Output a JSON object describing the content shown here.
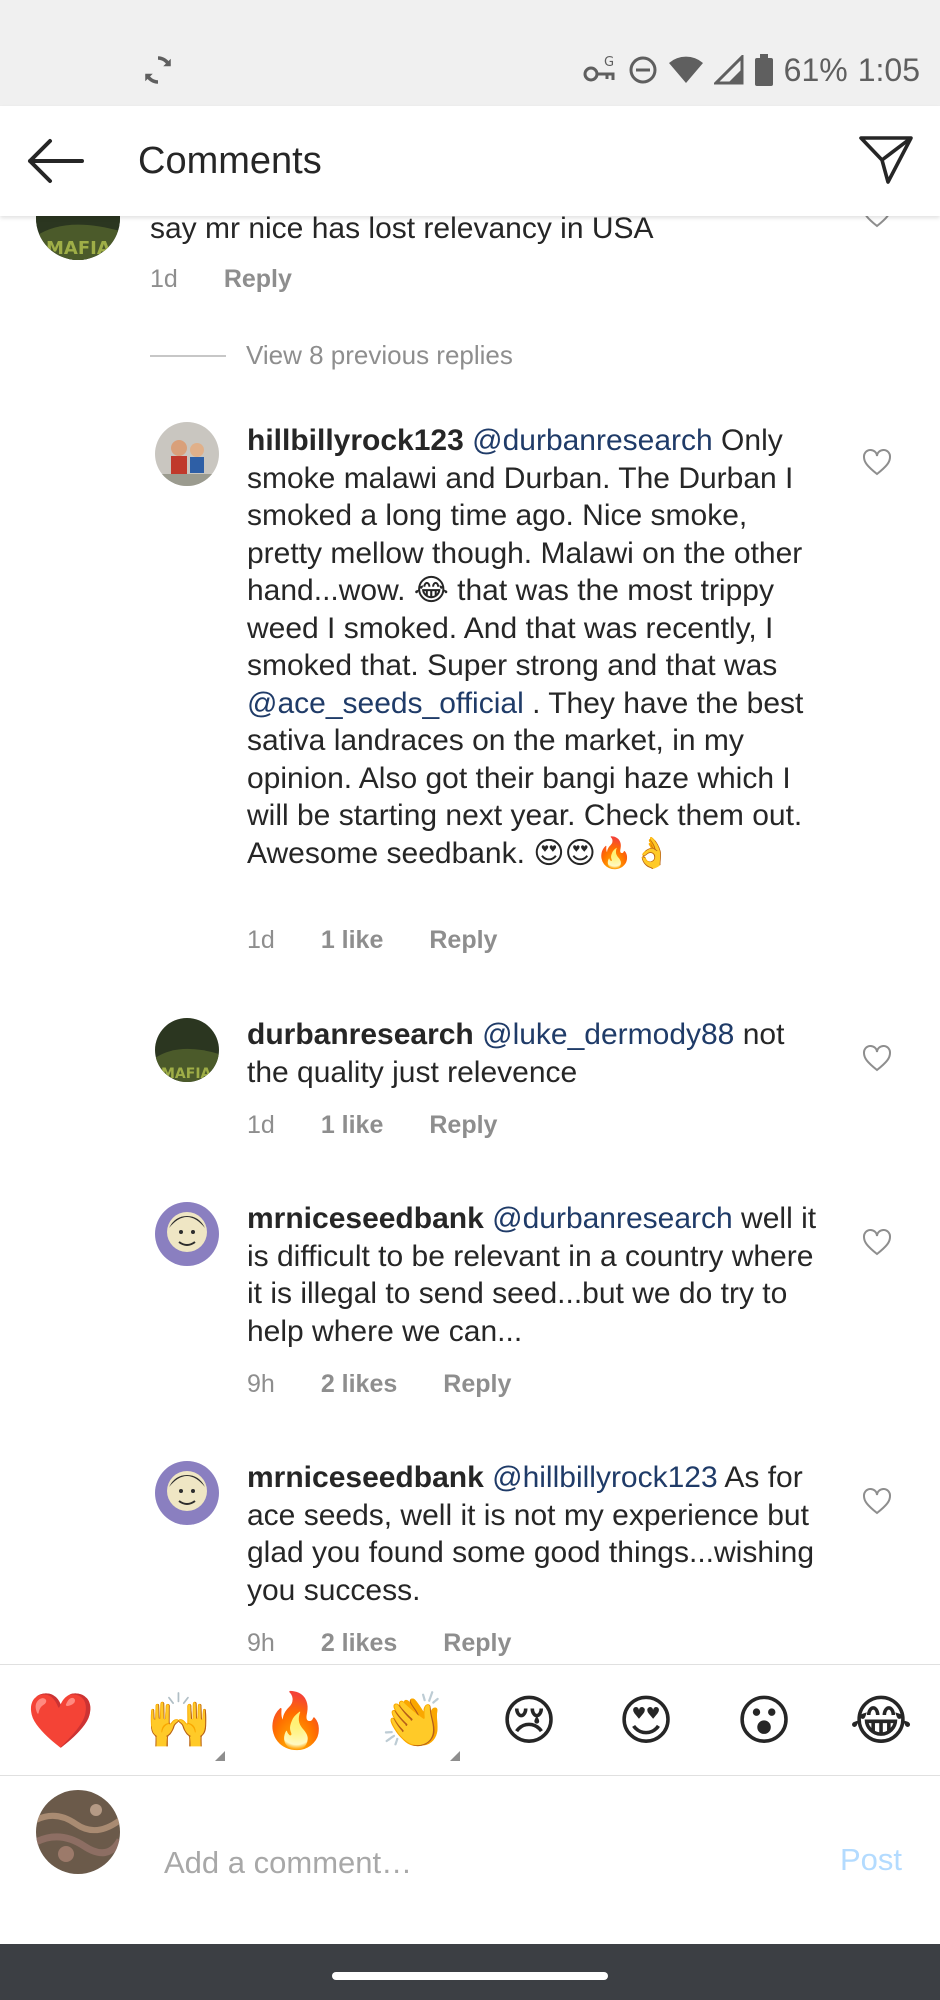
{
  "status_bar": {
    "battery": "61%",
    "time": "1:05"
  },
  "header": {
    "title": "Comments"
  },
  "parent_comment": {
    "text": "say mr nice has lost  relevancy in USA",
    "time": "1d",
    "reply_label": "Reply"
  },
  "view_replies": "View 8 previous replies",
  "replies": [
    {
      "username": "hillbillyrock123",
      "mention": "@durbanresearch",
      "text_1": " Only smoke malawi and Durban.  The Durban I smoked a long time ago. Nice smoke, pretty mellow though. Malawi on the other hand...wow. 😂 that was the most trippy weed I smoked. And that was recently, I smoked that. Super strong and that was  ",
      "mention_2": "@ace_seeds_official",
      "text_2": " . They have the best sativa landraces on the market, in my opinion. Also got their bangi haze which I will be starting next year. Check them out. Awesome seedbank. 😍😍🔥👌",
      "time": "1d",
      "likes": "1 like",
      "reply_label": "Reply"
    },
    {
      "username": "durbanresearch",
      "mention": "@luke_dermody88",
      "text_1": " not the quality just relevence",
      "time": "1d",
      "likes": "1 like",
      "reply_label": "Reply"
    },
    {
      "username": "mrniceseedbank",
      "mention": "@durbanresearch",
      "text_1": " well it is difficult to be relevant in a country where it is illegal to send seed...but we do try to help where we can...",
      "time": "9h",
      "likes": "2 likes",
      "reply_label": "Reply"
    },
    {
      "username": "mrniceseedbank",
      "mention": "@hillbillyrock123",
      "text_1": " As for ace seeds, well it is not my experience but glad you found some good things...wishing you success.",
      "time": "9h",
      "likes": "2 likes",
      "reply_label": "Reply"
    }
  ],
  "reactions": [
    {
      "emoji": "❤️",
      "name": "red-heart-reaction"
    },
    {
      "emoji": "🙌",
      "name": "raising-hands-reaction"
    },
    {
      "emoji": "🔥",
      "name": "fire-reaction"
    },
    {
      "emoji": "👏",
      "name": "clapping-hands-reaction"
    },
    {
      "emoji": "😢",
      "name": "crying-face-reaction"
    },
    {
      "emoji": "😍",
      "name": "heart-eyes-reaction"
    },
    {
      "emoji": "😮",
      "name": "surprised-face-reaction"
    },
    {
      "emoji": "😂",
      "name": "tears-of-joy-reaction"
    }
  ],
  "composer": {
    "placeholder": "Add a comment…",
    "post_label": "Post"
  },
  "colors": {
    "mention": "#1f3b68",
    "meta": "#8e8e8e",
    "post_disabled": "#b3dbff"
  }
}
